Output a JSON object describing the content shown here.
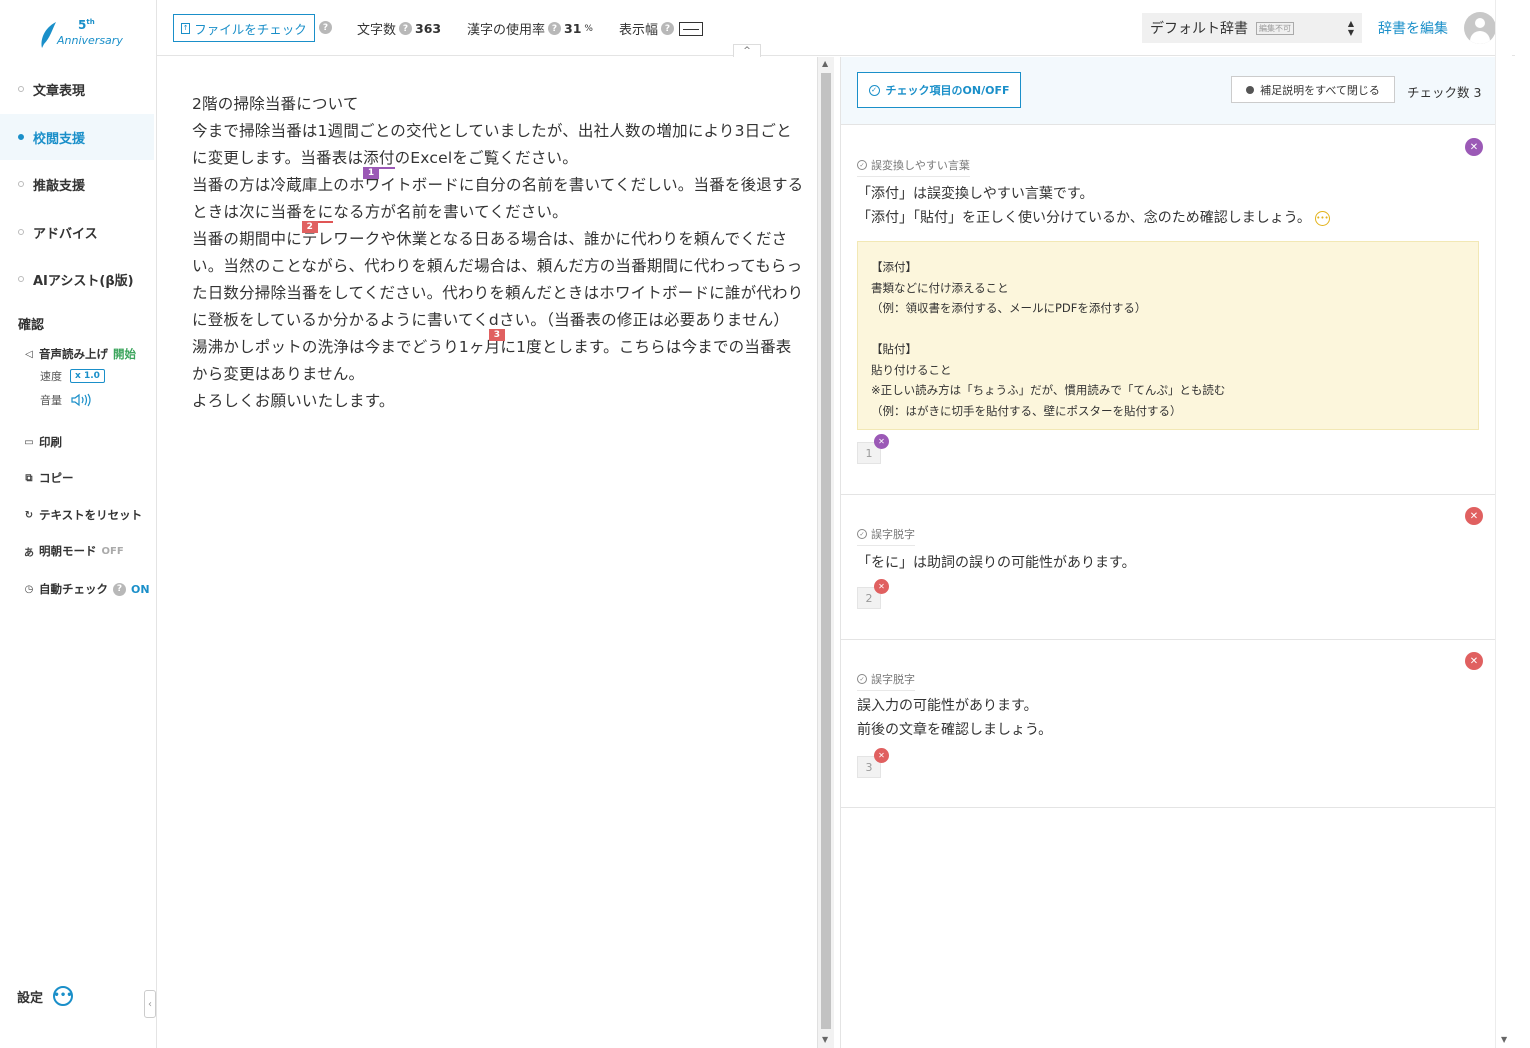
{
  "logo": {
    "number": "5",
    "suffix": "th",
    "label": "Anniversary"
  },
  "sidebar": {
    "nav": [
      {
        "label": "文章表現",
        "active": false
      },
      {
        "label": "校閲支援",
        "active": true
      },
      {
        "label": "推敲支援",
        "active": false
      },
      {
        "label": "アドバイス",
        "active": false
      },
      {
        "label": "AIアシスト(β版)",
        "active": false
      }
    ],
    "confirm_title": "確認",
    "voice": {
      "label": "音声読み上げ",
      "action": "開始",
      "speed_label": "速度",
      "speed_value": "x 1.0",
      "volume_label": "音量"
    },
    "print": "印刷",
    "copy": "コピー",
    "reset": "テキストをリセット",
    "mincho": {
      "label": "明朝モード",
      "state": "OFF"
    },
    "autocheck": {
      "label": "自動チェック",
      "state": "ON"
    },
    "settings": "設定"
  },
  "header": {
    "file_check": "ファイルをチェック",
    "char_count_label": "文字数",
    "char_count": "363",
    "kanji_label": "漢字の使用率",
    "kanji_rate": "31",
    "kanji_unit": "%",
    "width_label": "表示幅",
    "dict_name": "デフォルト辞書",
    "dict_badge": "編集不可",
    "edit_dict": "辞書を編集"
  },
  "editor": {
    "lines": {
      "l1": "2階の掃除当番について",
      "l2a": "今まで掃除当番は1週間ごとの交代としていましたが、出社人数の増加により3日ごとに変更します。当番表は",
      "l2_mark": "添付",
      "l2b": "のExcelをご覧ください。",
      "l3a": "当番の方は冷蔵庫上のホワイトボードに自分の名前を書いてくだしい。当番を後退するときは次に当番",
      "l3_mark": "をに",
      "l3b": "なる方が名前を書いてください。",
      "l4a": "当番の期間中にテレワークや休業となる日ある場合は、誰かに代わりを頼んでください。当然のことながら、代わりを頼んだ場合は、頼んだ方の当番期間に代わってもらった日数分掃除当番をしてください。代わりを頼んだときはホワイトボードに誰が代わりに登板をしているか分かるように書いてく",
      "l4_mark": "d",
      "l4b": "さい。（当番表の修正は必要ありません）",
      "l5": "湯沸かしポットの洗浄は今までどうり1ヶ月に1度とします。こちらは今までの当番表から変更はありません。",
      "l6": "よろしくお願いいたします。"
    },
    "marks": [
      "1",
      "2",
      "3"
    ]
  },
  "panel": {
    "toggle_button": "チェック項目のON/OFF",
    "close_all": "補足説明をすべて閉じる",
    "check_count_label": "チェック数",
    "check_count": "3",
    "cards": [
      {
        "category": "誤変換しやすい言葉",
        "lines": [
          "「添付」は誤変換しやすい言葉です。",
          "「添付」「貼付」を正しく使い分けているか、念のため確認しましょう。"
        ],
        "explanation": [
          "【添付】",
          "書類などに付け添えること",
          "（例：領収書を添付する、メールにPDFを添付する）",
          "",
          "【貼付】",
          "貼り付けること",
          "※正しい読み方は「ちょうふ」だが、慣用読みで「てんぷ」とも読む",
          "（例：はがきに切手を貼付する、壁にポスターを貼付する）"
        ],
        "number": "1",
        "color": "#9b59b6"
      },
      {
        "category": "誤字脱字",
        "lines": [
          "「をに」は助詞の誤りの可能性があります。"
        ],
        "number": "2",
        "color": "#e06060"
      },
      {
        "category": "誤字脱字",
        "lines": [
          "誤入力の可能性があります。",
          "前後の文章を確認しましょう。"
        ],
        "number": "3",
        "color": "#e06060"
      }
    ]
  }
}
